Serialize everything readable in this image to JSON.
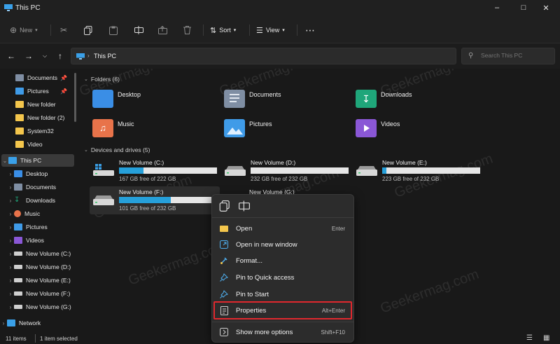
{
  "window": {
    "title": "This PC"
  },
  "toolbar": {
    "new_label": "New",
    "sort_label": "Sort",
    "view_label": "View"
  },
  "address": {
    "location": "This PC"
  },
  "search": {
    "placeholder": "Search This PC"
  },
  "sidebar": {
    "pinned": [
      {
        "label": "Documents",
        "icon": "documents-icon"
      },
      {
        "label": "Pictures",
        "icon": "pictures-icon"
      },
      {
        "label": "New folder",
        "icon": "folder-icon"
      },
      {
        "label": "New folder (2)",
        "icon": "folder-icon"
      },
      {
        "label": "System32",
        "icon": "folder-icon"
      },
      {
        "label": "Video",
        "icon": "folder-icon"
      }
    ],
    "this_pc": "This PC",
    "children": [
      {
        "label": "Desktop",
        "icon": "desktop-icon"
      },
      {
        "label": "Documents",
        "icon": "documents-icon"
      },
      {
        "label": "Downloads",
        "icon": "downloads-icon"
      },
      {
        "label": "Music",
        "icon": "music-icon"
      },
      {
        "label": "Pictures",
        "icon": "pictures-icon"
      },
      {
        "label": "Videos",
        "icon": "videos-icon"
      },
      {
        "label": "New Volume (C:)",
        "icon": "drive-icon"
      },
      {
        "label": "New Volume (D:)",
        "icon": "drive-icon"
      },
      {
        "label": "New Volume (E:)",
        "icon": "drive-icon"
      },
      {
        "label": "New Volume (F:)",
        "icon": "drive-icon"
      },
      {
        "label": "New Volume (G:)",
        "icon": "drive-icon"
      }
    ],
    "network": "Network"
  },
  "folders": {
    "header": "Folders (6)",
    "items": [
      {
        "label": "Desktop",
        "color": "#3a8ee6"
      },
      {
        "label": "Documents",
        "color": "#7f8ea3"
      },
      {
        "label": "Downloads",
        "color": "#1fa67a"
      },
      {
        "label": "Music",
        "color": "#e8734a"
      },
      {
        "label": "Pictures",
        "color": "#3f9be8"
      },
      {
        "label": "Videos",
        "color": "#8a57d6"
      }
    ]
  },
  "drives": {
    "header": "Devices and drives (5)",
    "items": [
      {
        "name": "New Volume (C:)",
        "free": "167 GB free of 222 GB",
        "used_fraction": 0.25
      },
      {
        "name": "New Volume (D:)",
        "free": "232 GB free of 232 GB",
        "used_fraction": 0.0
      },
      {
        "name": "New Volume (E:)",
        "free": "223 GB free of 232 GB",
        "used_fraction": 0.04
      },
      {
        "name": "New Volume (F:)",
        "free": "101 GB free of 232 GB",
        "used_fraction": 0.56
      },
      {
        "name": "New Volume (G:)",
        "free": "",
        "used_fraction": 0.0
      }
    ]
  },
  "context_menu": {
    "items": [
      {
        "label": "Open",
        "shortcut": "Enter",
        "icon": "folder-open-icon"
      },
      {
        "label": "Open in new window",
        "shortcut": "",
        "icon": "open-new-window-icon"
      },
      {
        "label": "Format...",
        "shortcut": "",
        "icon": "format-icon"
      },
      {
        "label": "Pin to Quick access",
        "shortcut": "",
        "icon": "pin-icon"
      },
      {
        "label": "Pin to Start",
        "shortcut": "",
        "icon": "pin-start-icon"
      },
      {
        "label": "Properties",
        "shortcut": "Alt+Enter",
        "icon": "properties-icon"
      },
      {
        "label": "Show more options",
        "shortcut": "Shift+F10",
        "icon": "more-options-icon"
      }
    ]
  },
  "status": {
    "count": "11 items",
    "selected": "1 item selected"
  },
  "watermark": "Geekermag.com",
  "colors": {
    "accent": "#26a0da",
    "highlight": "#e0282e"
  }
}
